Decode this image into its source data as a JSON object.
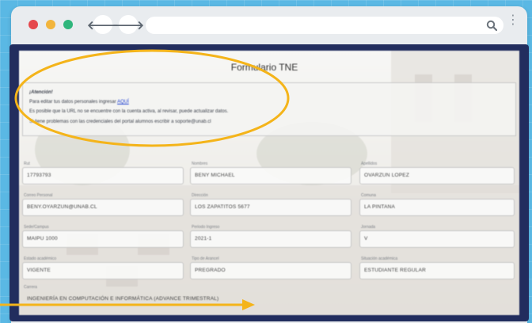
{
  "browser": {
    "back_icon": "arrow-left-icon",
    "forward_icon": "arrow-right-icon",
    "search_icon": "search-icon",
    "menu_icon": "kebab-menu-icon",
    "back_glyph": "🡐",
    "forward_glyph": "🡒",
    "menu_glyph": "⋮"
  },
  "form": {
    "title": "Formulario TNE",
    "notice": {
      "title": "¡Atención!",
      "line1_prefix": "Para editar tus datos personales ingresar ",
      "line1_link": "AQUÍ",
      "line2": "Es posible que la URL no se encuentre con la cuenta activa, al revisar, puede actualizar datos.",
      "line3": "Si tiene problemas con las credenciales del portal alumnos escribir a soporte@unab.cl"
    },
    "fields": [
      {
        "label": "Rut",
        "value": "17793793"
      },
      {
        "label": "Nombres",
        "value": "BENY MICHAEL"
      },
      {
        "label": "Apellidos",
        "value": "OVARZUN LOPEZ"
      },
      {
        "label": "Correo Personal",
        "value": "BENY.OYARZUN@UNAB.CL"
      },
      {
        "label": "Dirección",
        "value": "LOS ZAPATITOS 5677"
      },
      {
        "label": "Comuna",
        "value": "LA PINTANA"
      },
      {
        "label": "Sede/Campus",
        "value": "MAIPU 1000"
      },
      {
        "label": "Periodo Ingreso",
        "value": "2021-1"
      },
      {
        "label": "Jornada",
        "value": "V"
      },
      {
        "label": "Estado académico",
        "value": "VIGENTE"
      },
      {
        "label": "Tipo de Arancel",
        "value": "PREGRADO"
      },
      {
        "label": "Situación académica",
        "value": "ESTUDIANTE REGULAR"
      },
      {
        "label": "Carrera",
        "value": "INGENIERÍA EN COMPUTACIÓN E INFORMÁTICA (ADVANCE TRIMESTRAL)"
      }
    ]
  },
  "colors": {
    "background": "#5ab8e4",
    "frame": "#222d5e",
    "annotation": "#f4b41a",
    "link": "#1d3fd0"
  }
}
